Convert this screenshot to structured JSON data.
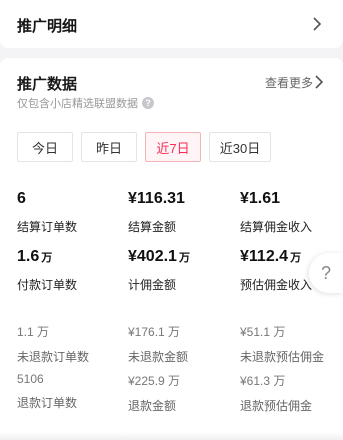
{
  "detail": {
    "title": "推广明细"
  },
  "data_section": {
    "title": "推广数据",
    "view_more": "查看更多",
    "subtitle": "仅包含小店精选联盟数据",
    "help_glyph": "?"
  },
  "tabs": [
    {
      "label": "今日",
      "active": false
    },
    {
      "label": "昨日",
      "active": false
    },
    {
      "label": "近7日",
      "active": true
    },
    {
      "label": "近30日",
      "active": false
    }
  ],
  "stats": {
    "settle_orders": {
      "value": "6",
      "unit": "",
      "label": "结算订单数"
    },
    "settle_amount": {
      "value": "¥116.31",
      "unit": "",
      "label": "结算金额"
    },
    "settle_commission": {
      "value": "¥1.61",
      "unit": "",
      "label": "结算佣金收入"
    },
    "paid_orders": {
      "value": "1.6",
      "unit": "万",
      "label": "付款订单数"
    },
    "commission_amount": {
      "value": "¥402.1",
      "unit": "万",
      "label": "计佣金额"
    },
    "est_commission": {
      "value": "¥112.4",
      "unit": "万",
      "label": "预估佣金收入"
    },
    "unrefunded_orders": {
      "value": "1.1 万",
      "label": "未退款订单数"
    },
    "unrefunded_amount": {
      "value": "¥176.1 万",
      "label": "未退款金额"
    },
    "unrefunded_est_commission": {
      "value": "¥51.1 万",
      "label": "未退款预估佣金"
    },
    "refund_orders": {
      "value": "5106",
      "label": "退款订单数"
    },
    "refund_amount": {
      "value": "¥225.9 万",
      "label": "退款金额"
    },
    "refund_est_commission": {
      "value": "¥61.3 万",
      "label": "退款预估佣金"
    }
  },
  "floating_help": {
    "glyph": "?"
  }
}
